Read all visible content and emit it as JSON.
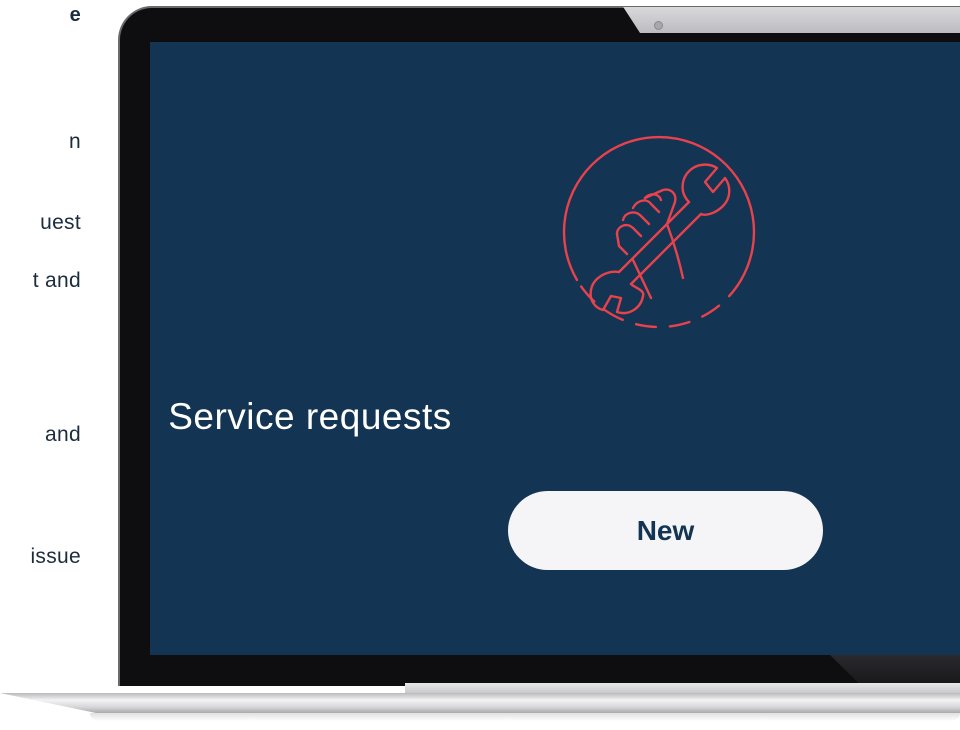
{
  "side_text": {
    "lines": [
      "e",
      "n",
      "uest",
      "t and",
      "and",
      "issue"
    ]
  },
  "screen": {
    "title": "Service requests",
    "new_button_label": "New"
  },
  "icons": {
    "service": "wrench-in-hand-icon"
  },
  "colors": {
    "screen_bg": "#133452",
    "icon_accent": "#e8424d",
    "button_bg": "#f5f5f7",
    "button_text": "#133452",
    "side_text": "#1c2c3f"
  }
}
